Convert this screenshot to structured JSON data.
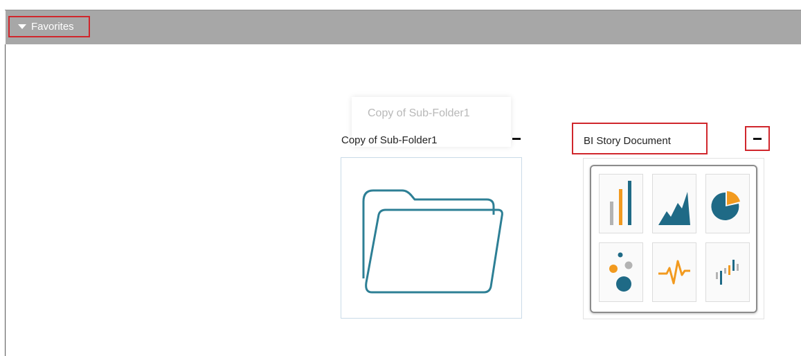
{
  "header": {
    "favorites_label": "Favorites"
  },
  "drag_ghost": {
    "label": "Copy of Sub-Folder1"
  },
  "items": [
    {
      "title": "Copy of Sub-Folder1",
      "type": "folder",
      "icon": "folder-icon"
    },
    {
      "title": "BI Story Document",
      "type": "bi-story",
      "icon": "bi-story-icon"
    }
  ],
  "colors": {
    "header_bg": "#a7a7a7",
    "highlight": "#d0262c",
    "chart_teal": "#1f6a86",
    "chart_orange": "#f29a1f",
    "chart_grey": "#b3b3b3"
  }
}
